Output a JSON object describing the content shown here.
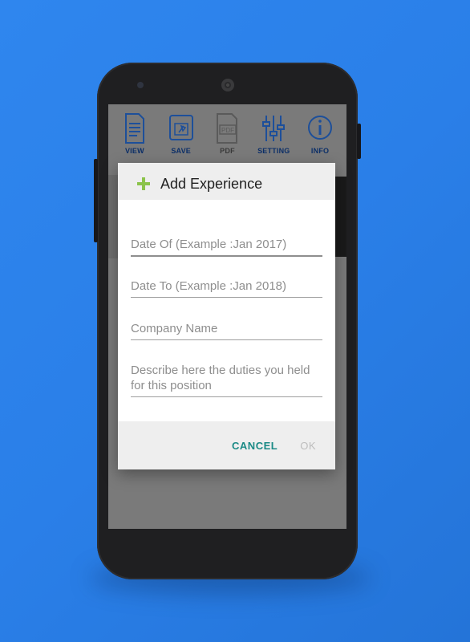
{
  "toolbar": {
    "items": [
      {
        "label": "VIEW",
        "icon": "document-view-icon"
      },
      {
        "label": "SAVE",
        "icon": "save-pin-icon"
      },
      {
        "label": "PDF",
        "icon": "pdf-file-icon"
      },
      {
        "label": "SETTING",
        "icon": "sliders-icon"
      },
      {
        "label": "INFO",
        "icon": "info-icon"
      }
    ]
  },
  "dialog": {
    "title": "Add Experience",
    "fields": [
      {
        "placeholder": "Date Of (Example :Jan 2017)"
      },
      {
        "placeholder": "Date To (Example :Jan 2018)"
      },
      {
        "placeholder": "Company Name"
      },
      {
        "placeholder": "Describe here the duties you held for this position"
      }
    ],
    "cancel_label": "CANCEL",
    "ok_label": "OK"
  },
  "colors": {
    "background": "#2a7fe8",
    "accent_green": "#8bc34a",
    "button_teal": "#1b8a86",
    "toolbar_icon": "#1d4f9a"
  }
}
